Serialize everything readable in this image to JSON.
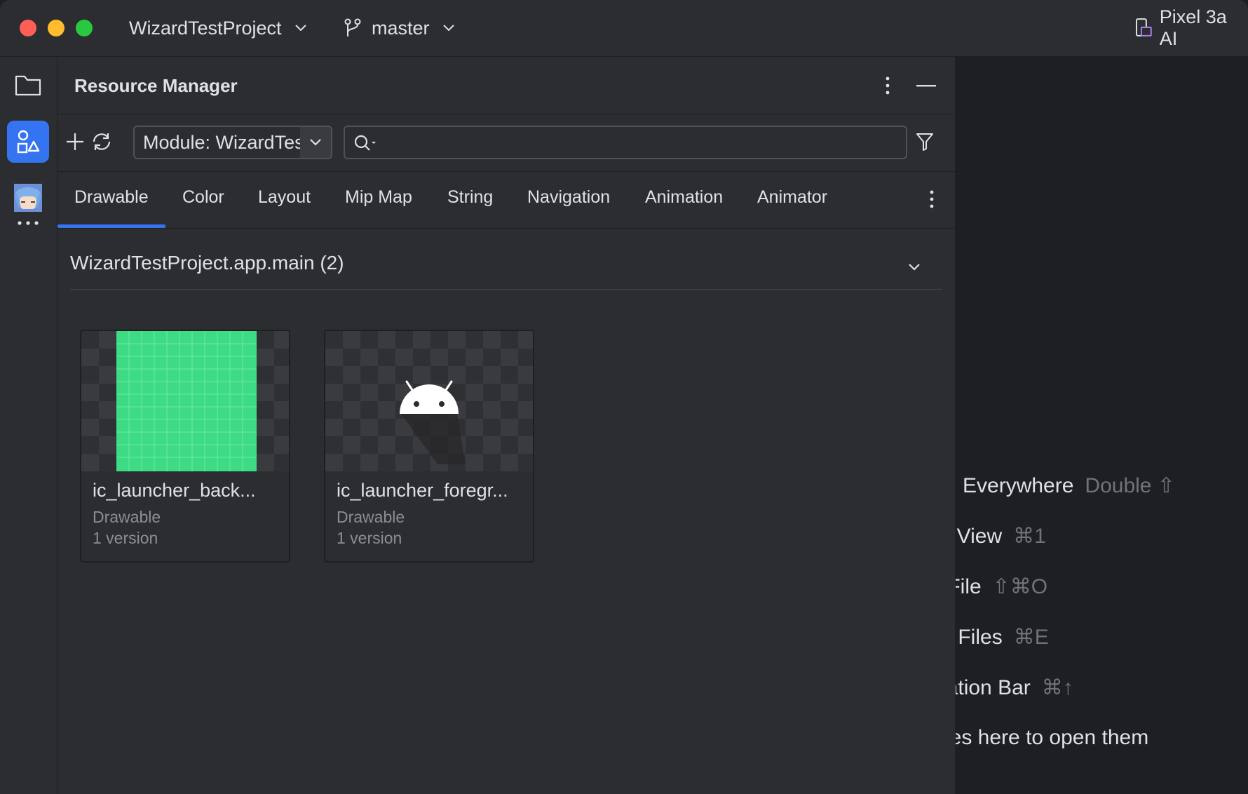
{
  "titlebar": {
    "project": "WizardTestProject",
    "branch": "master",
    "device": "Pixel 3a AI"
  },
  "strip": {
    "icons": [
      "folder-icon",
      "resource-manager-icon",
      "avatar",
      "more-icon"
    ]
  },
  "panel": {
    "title": "Resource Manager",
    "module_select": "Module: WizardTestProject.app",
    "search_placeholder": "",
    "tabs": [
      {
        "label": "Drawable",
        "active": true
      },
      {
        "label": "Color"
      },
      {
        "label": "Layout"
      },
      {
        "label": "Mip Map"
      },
      {
        "label": "String"
      },
      {
        "label": "Navigation"
      },
      {
        "label": "Animation"
      },
      {
        "label": "Animator"
      }
    ],
    "group": {
      "title": "WizardTestProject.app.main (2)",
      "items": [
        {
          "name": "ic_launcher_back...",
          "type": "Drawable",
          "versions": "1 version"
        },
        {
          "name": "ic_launcher_foregr...",
          "type": "Drawable",
          "versions": "1 version"
        }
      ]
    }
  },
  "editor_hints": [
    {
      "label": "ch Everywhere",
      "shortcut": "Double ⇧"
    },
    {
      "label": "ct View",
      "shortcut": "⌘1"
    },
    {
      "label": ") File",
      "shortcut": "⇧⌘O"
    },
    {
      "label": "nt Files",
      "shortcut": "⌘E"
    },
    {
      "label": "gation Bar",
      "shortcut": "⌘↑"
    },
    {
      "label": " files here to open them",
      "shortcut": ""
    }
  ],
  "colors": {
    "accent": "#3574f0",
    "background_green": "#3ddc84",
    "panel_bg": "#2b2d30",
    "editor_bg": "#1e1f22"
  }
}
